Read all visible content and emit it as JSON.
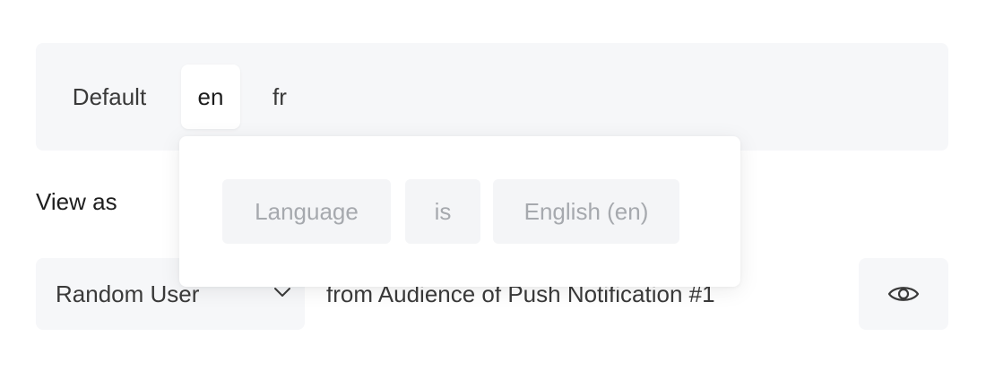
{
  "language_tabs": [
    {
      "label": "Default",
      "selected": false
    },
    {
      "label": "en",
      "selected": true
    },
    {
      "label": "fr",
      "selected": false
    }
  ],
  "popover": {
    "field": "Language",
    "operator": "is",
    "value": "English (en)"
  },
  "view_as": {
    "label": "View as",
    "user_select_value": "Random User",
    "audience_text": "from Audience of Push Notification #1"
  },
  "icons": {
    "dropdown": "chevron-down-icon",
    "preview": "eye-icon"
  },
  "colors": {
    "panel_bg": "#f6f7f9",
    "chip_text": "#a6a9ae",
    "text": "#3a3a3a"
  }
}
